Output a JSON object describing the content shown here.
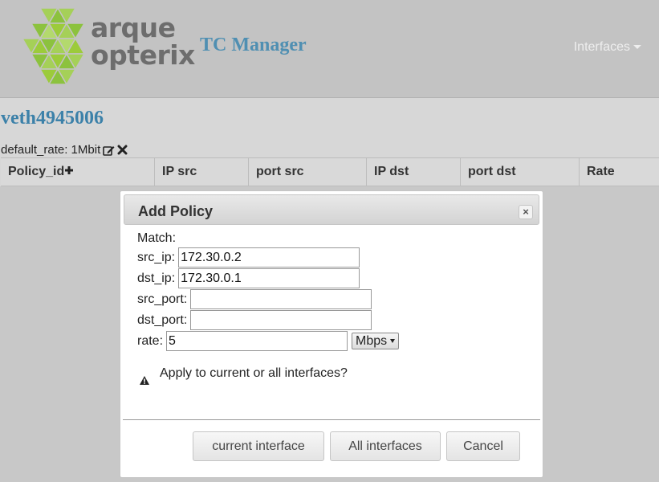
{
  "header": {
    "brand_line1": "arque",
    "brand_line2": "opterix",
    "app_title": "TC Manager",
    "nav_interfaces": "Interfaces"
  },
  "interface": {
    "name": "veth4945006",
    "default_rate": "default_rate: 1Mbit"
  },
  "table": {
    "columns": [
      "Policy_id",
      "IP src",
      "port src",
      "IP dst",
      "port dst",
      "Rate"
    ]
  },
  "dialog": {
    "title": "Add Policy",
    "close_glyph": "×",
    "match_label": "Match:",
    "src_ip_label": "src_ip:",
    "src_ip_value": "172.30.0.2",
    "dst_ip_label": "dst_ip:",
    "dst_ip_value": "172.30.0.1",
    "src_port_label": "src_port:",
    "src_port_value": "",
    "dst_port_label": "dst_port:",
    "dst_port_value": "",
    "rate_label": "rate:",
    "rate_value": "5",
    "rate_unit": "Mbps",
    "question": "Apply to current or all interfaces?",
    "buttons": {
      "current": "current interface",
      "all": "All interfaces",
      "cancel": "Cancel"
    }
  },
  "icons": {
    "logo": "arque-opterix-logo",
    "edit": "edit-icon",
    "delete": "close-icon",
    "add": "plus-icon",
    "warning": "warning-icon"
  },
  "colors": {
    "accent": "#4f8fb2",
    "logo_green": "#9ccb3b"
  }
}
